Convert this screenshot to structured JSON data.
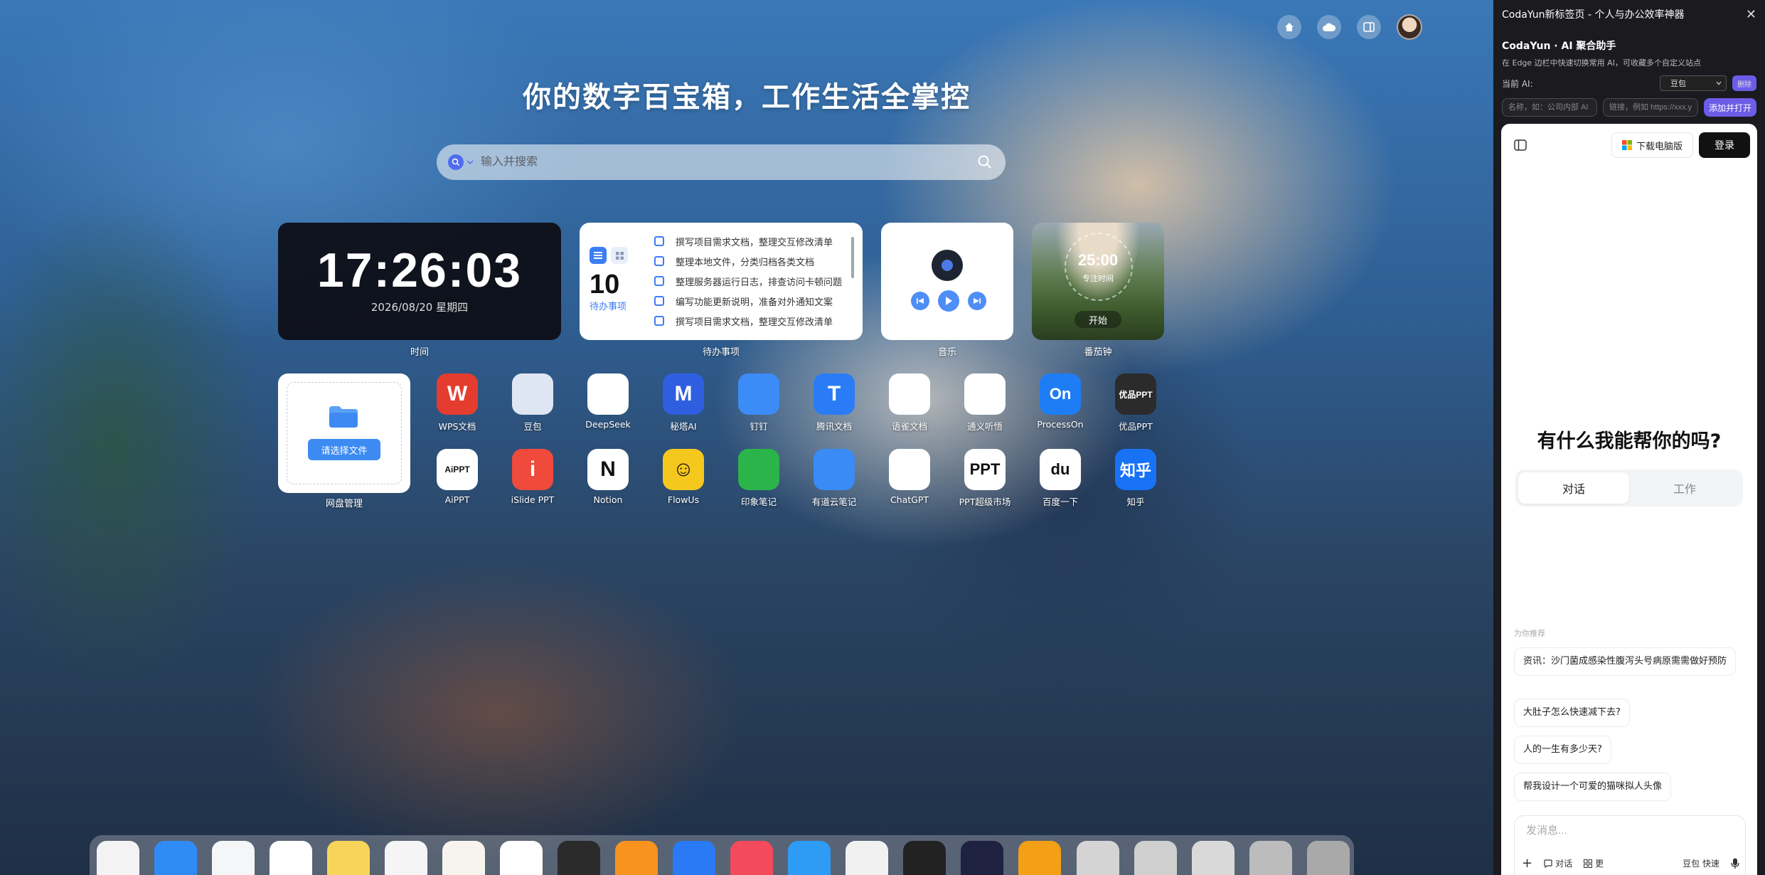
{
  "headline": "你的数字百宝箱，工作生活全掌控",
  "search": {
    "placeholder": "输入并搜索"
  },
  "clock": {
    "time": "17:26:03",
    "date": "2026/08/20 星期四",
    "label": "时间"
  },
  "todo": {
    "count": "10",
    "count_label": "待办事项",
    "label": "待办事项",
    "items": [
      "撰写项目需求文档，整理交互修改清单",
      "整理本地文件，分类归档各类文档",
      "整理服务器运行日志，排查访问卡顿问题",
      "编写功能更新说明，准备对外通知文案",
      "撰写项目需求文档，整理交互修改清单"
    ]
  },
  "music": {
    "label": "音乐"
  },
  "pomodoro": {
    "time": "25:00",
    "focus_label": "专注时间",
    "start": "开始",
    "label": "番茄钟"
  },
  "netdisk": {
    "button": "请选择文件",
    "label": "网盘管理"
  },
  "apps": [
    {
      "name": "WPS文档",
      "color": "#e43d30",
      "glyph": "W"
    },
    {
      "name": "豆包",
      "color": "#dfe6f3",
      "glyph": ""
    },
    {
      "name": "DeepSeek",
      "color": "#ffffff",
      "glyph": ""
    },
    {
      "name": "秘塔AI",
      "color": "#2f5fe0",
      "glyph": "M"
    },
    {
      "name": "钉钉",
      "color": "#3c8cf7",
      "glyph": ""
    },
    {
      "name": "腾讯文档",
      "color": "#2a7cf6",
      "glyph": "T"
    },
    {
      "name": "语雀文档",
      "color": "#ffffff",
      "glyph": ""
    },
    {
      "name": "通义听悟",
      "color": "#ffffff",
      "glyph": ""
    },
    {
      "name": "ProcessOn",
      "color": "#1e7df5",
      "glyph": "On"
    },
    {
      "name": "优品PPT",
      "color": "#2b2b2b",
      "glyph": "优品PPT"
    },
    {
      "name": "AiPPT",
      "color": "#ffffff",
      "glyph": "AiPPT"
    },
    {
      "name": "iSlide PPT",
      "color": "#ef4a3c",
      "glyph": "i"
    },
    {
      "name": "Notion",
      "color": "#ffffff",
      "glyph": "N"
    },
    {
      "name": "FlowUs",
      "color": "#f5c81e",
      "glyph": "☺"
    },
    {
      "name": "印象笔记",
      "color": "#2ab44a",
      "glyph": ""
    },
    {
      "name": "有道云笔记",
      "color": "#3a8bf6",
      "glyph": ""
    },
    {
      "name": "ChatGPT",
      "color": "#ffffff",
      "glyph": ""
    },
    {
      "name": "PPT超级市场",
      "color": "#ffffff",
      "glyph": "PPT"
    },
    {
      "name": "百度一下",
      "color": "#ffffff",
      "glyph": "du"
    },
    {
      "name": "知乎",
      "color": "#1772f6",
      "glyph": "知乎"
    }
  ],
  "dock": [
    "#f3f3f3",
    "#2f8cf6",
    "#f4f6f8",
    "#ffffff",
    "#f8d55a",
    "#f5f5f5",
    "#f7f4ee",
    "#ffffff",
    "#2b2b2b",
    "#f7931e",
    "#2a7af5",
    "#f34a5c",
    "#2e9bf5",
    "#f1f1f1",
    "#222222",
    "#1e2140",
    "#f3a016",
    "#d4d4d4",
    "#cfcfcf",
    "#d9d9d9",
    "#bcbcbc",
    "#a9a9a9"
  ],
  "sidebar": {
    "window_title": "CodaYun新标签页 - 个人与办公效率神器",
    "title": "CodaYun · AI 聚合助手",
    "desc": "在 Edge 边栏中快速切换常用 AI，可收藏多个自定义站点",
    "current_ai_label": "当前 AI:",
    "current_ai": "豆包",
    "delete": "删除",
    "name_placeholder": "名称，如：公司内部 AI",
    "url_placeholder": "链接，例如 https://xxx.y",
    "add_open": "添加并打开"
  },
  "chat": {
    "download": "下载电脑版",
    "login": "登录",
    "question": "有什么我能帮你的吗?",
    "tab_chat": "对话",
    "tab_work": "工作",
    "recommend_label": "为你推荐",
    "suggestions": [
      "资讯：沙门菌成感染性腹泻头号病原需需做好预防",
      "大肚子怎么快速减下去?",
      "人的一生有多少天?",
      "帮我设计一个可爱的猫咪拟人头像"
    ],
    "input_placeholder": "发消息...",
    "mode_chat": "对话",
    "mode_more": "更",
    "mode_fast": "豆包 快速"
  },
  "colors": {
    "accent": "#3d7df5",
    "sidebar_bg": "#1a1a1f",
    "purple": "#6c5ce7"
  }
}
